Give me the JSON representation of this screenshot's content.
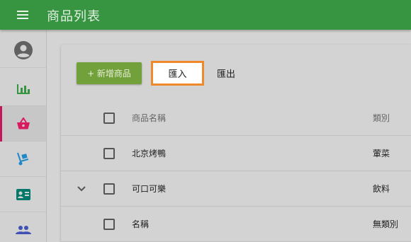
{
  "app": {
    "title": "商品列表"
  },
  "sidebar": {
    "items": [
      {
        "icon": "account-circle-icon"
      },
      {
        "icon": "bar-chart-icon"
      },
      {
        "icon": "basket-icon",
        "active": true
      },
      {
        "icon": "hand-truck-icon"
      },
      {
        "icon": "contact-card-icon"
      },
      {
        "icon": "people-icon"
      }
    ]
  },
  "toolbar": {
    "add_label": "+ 新增商品",
    "import_label": "匯入",
    "export_label": "匯出"
  },
  "table": {
    "headers": {
      "name": "商品名稱",
      "category": "類別"
    },
    "rows": [
      {
        "name": "北京烤鴨",
        "category": "葷菜",
        "expandable": false
      },
      {
        "name": "可口可樂",
        "category": "飲料",
        "expandable": true
      },
      {
        "name": "名稱",
        "category": "無類別",
        "expandable": false
      }
    ]
  },
  "colors": {
    "appbar": "#379440",
    "add_button": "#72a03a",
    "import_border": "#ef8a2c",
    "active_indicator": "#c2185b"
  }
}
